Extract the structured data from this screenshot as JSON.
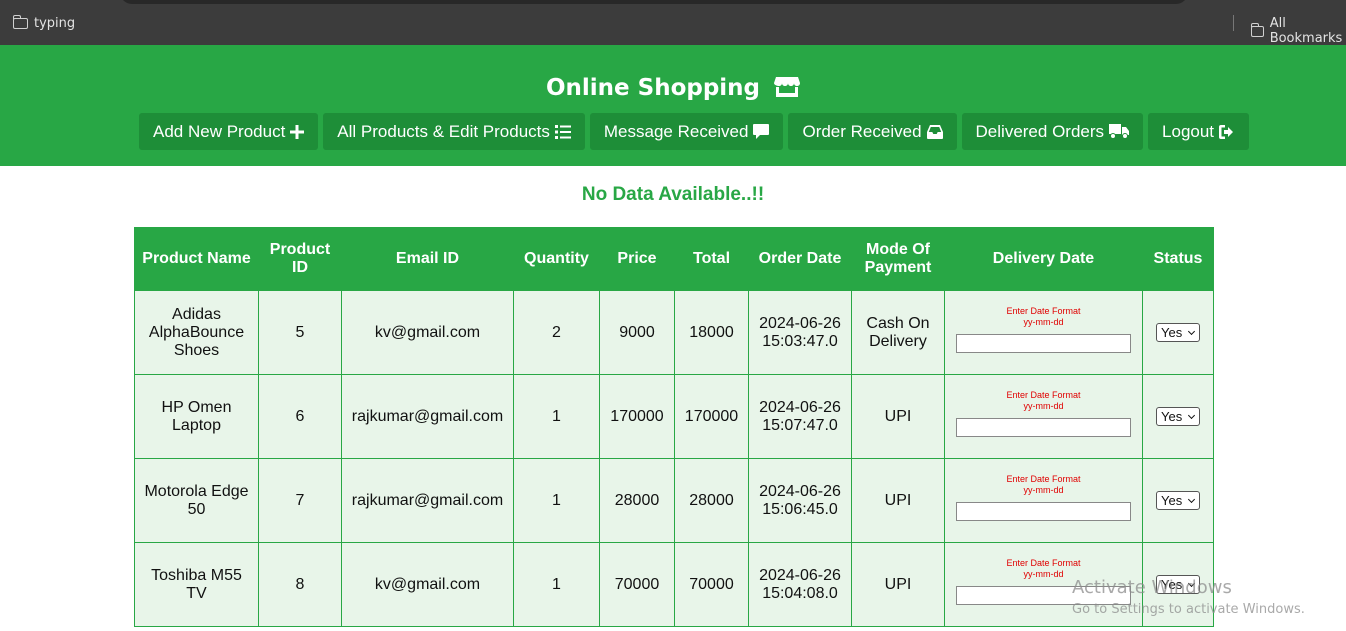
{
  "browser": {
    "bookmark_left": "typing",
    "bookmark_right": "All Bookmarks"
  },
  "header": {
    "title": "Online Shopping",
    "title_icon": "store-icon",
    "nav": [
      {
        "label": "Add New Product",
        "icon": "plus-icon"
      },
      {
        "label": "All Products & Edit Products",
        "icon": "list-icon"
      },
      {
        "label": "Message Received",
        "icon": "comment-icon"
      },
      {
        "label": "Order Received",
        "icon": "inbox-icon"
      },
      {
        "label": "Delivered Orders",
        "icon": "truck-icon"
      },
      {
        "label": "Logout",
        "icon": "sign-out-icon"
      }
    ]
  },
  "main": {
    "no_data": "No Data Available..!!"
  },
  "table": {
    "headers": [
      "Product Name",
      "Product ID",
      "Email ID",
      "Quantity",
      "Price",
      "Total",
      "Order Date",
      "Mode Of Payment",
      "Delivery Date",
      "Status"
    ],
    "date_hint_line1": "Enter Date Format",
    "date_hint_line2": "yy-mm-dd",
    "rows": [
      {
        "name": "Adidas AlphaBounce Shoes",
        "id": "5",
        "email": "kv@gmail.com",
        "qty": "2",
        "price": "9000",
        "total": "18000",
        "date": "2024-06-26 15:03:47.0",
        "payment": "Cash On Delivery",
        "delivery": "",
        "status": "Yes"
      },
      {
        "name": "HP Omen Laptop",
        "id": "6",
        "email": "rajkumar@gmail.com",
        "qty": "1",
        "price": "170000",
        "total": "170000",
        "date": "2024-06-26 15:07:47.0",
        "payment": "UPI",
        "delivery": "",
        "status": "Yes"
      },
      {
        "name": "Motorola Edge 50",
        "id": "7",
        "email": "rajkumar@gmail.com",
        "qty": "1",
        "price": "28000",
        "total": "28000",
        "date": "2024-06-26 15:06:45.0",
        "payment": "UPI",
        "delivery": "",
        "status": "Yes"
      },
      {
        "name": "Toshiba M55 TV",
        "id": "8",
        "email": "kv@gmail.com",
        "qty": "1",
        "price": "70000",
        "total": "70000",
        "date": "2024-06-26 15:04:08.0",
        "payment": "UPI",
        "delivery": "",
        "status": "Yes"
      }
    ]
  },
  "watermark": {
    "line1": "Activate Windows",
    "line2": "Go to Settings to activate Windows."
  },
  "colors": {
    "brand_green": "#28a745",
    "button_green": "#1e8e38",
    "cell_bg": "#e8f5e9",
    "hint_red": "#e00000"
  }
}
